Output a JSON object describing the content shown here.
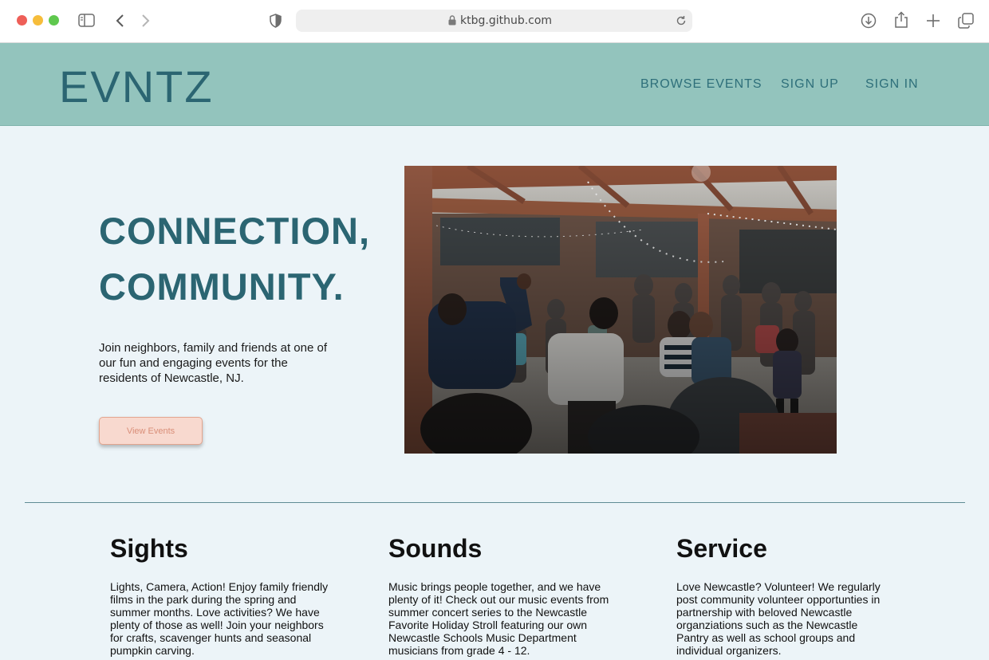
{
  "browser": {
    "url": "ktbg.github.com"
  },
  "site": {
    "logo": "EVNTZ",
    "nav": [
      {
        "label": "BROWSE EVENTS"
      },
      {
        "label": "SIGN UP"
      },
      {
        "label": "SIGN IN"
      }
    ]
  },
  "hero": {
    "headline_line1": "CONNECTION,",
    "headline_line2": "COMMUNITY.",
    "body": "Join neighbors, family and friends at one of our fun and engaging events for the residents of Newcastle, NJ.",
    "button_label": "View Events"
  },
  "features": [
    {
      "title": "Sights",
      "text": "Lights, Camera, Action! Enjoy family friendly films in the park during the spring and summer months. Love activities? We have plenty of those as well! Join your neighbors for crafts, scavenger hunts and seasonal pumpkin carving."
    },
    {
      "title": "Sounds",
      "text": "Music brings people together, and we have plenty of it! Check out our music events from summer concert series to the Newcastle Favorite Holiday Stroll featuring our own Newcastle Schools Music Department musicians from grade 4 - 12."
    },
    {
      "title": "Service",
      "text": "Love Newcastle? Volunteer! We regularly post community volunteer opportunties in partnership with beloved Newcastle organziations such as the Newcastle Pantry as well as school groups and individual organizers."
    }
  ],
  "colors": {
    "header_bg": "#93c4bd",
    "brand_text": "#2b6572",
    "page_bg": "#ecf4f8",
    "button_bg": "#f8d9cf"
  }
}
